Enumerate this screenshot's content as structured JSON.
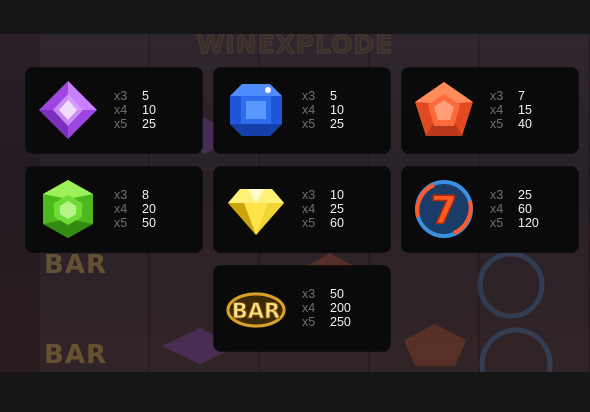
{
  "game": {
    "title": "WINEXPLODE"
  },
  "background": {
    "bar_labels": [
      "BAR",
      "BAR"
    ]
  },
  "paytable": [
    {
      "symbol": "purple-gem-icon",
      "color": "#b45cf0",
      "pays": [
        {
          "mult": "x3",
          "amount": "5"
        },
        {
          "mult": "x4",
          "amount": "10"
        },
        {
          "mult": "x5",
          "amount": "25"
        }
      ]
    },
    {
      "symbol": "blue-gem-icon",
      "color": "#2f6df2",
      "pays": [
        {
          "mult": "x3",
          "amount": "5"
        },
        {
          "mult": "x4",
          "amount": "10"
        },
        {
          "mult": "x5",
          "amount": "25"
        }
      ]
    },
    {
      "symbol": "red-gem-icon",
      "color": "#f0542b",
      "pays": [
        {
          "mult": "x3",
          "amount": "7"
        },
        {
          "mult": "x4",
          "amount": "15"
        },
        {
          "mult": "x5",
          "amount": "40"
        }
      ]
    },
    {
      "symbol": "green-gem-icon",
      "color": "#5ed02a",
      "pays": [
        {
          "mult": "x3",
          "amount": "8"
        },
        {
          "mult": "x4",
          "amount": "20"
        },
        {
          "mult": "x5",
          "amount": "50"
        }
      ]
    },
    {
      "symbol": "yellow-diamond-icon",
      "color": "#f6d21c",
      "pays": [
        {
          "mult": "x3",
          "amount": "10"
        },
        {
          "mult": "x4",
          "amount": "25"
        },
        {
          "mult": "x5",
          "amount": "60"
        }
      ]
    },
    {
      "symbol": "lucky-seven-icon",
      "color": "#e8421f",
      "pays": [
        {
          "mult": "x3",
          "amount": "25"
        },
        {
          "mult": "x4",
          "amount": "60"
        },
        {
          "mult": "x5",
          "amount": "120"
        }
      ]
    },
    {
      "symbol": "bar-icon",
      "label": "BAR",
      "color": "#e9b23a",
      "pays": [
        {
          "mult": "x3",
          "amount": "50"
        },
        {
          "mult": "x4",
          "amount": "200"
        },
        {
          "mult": "x5",
          "amount": "250"
        }
      ]
    }
  ]
}
